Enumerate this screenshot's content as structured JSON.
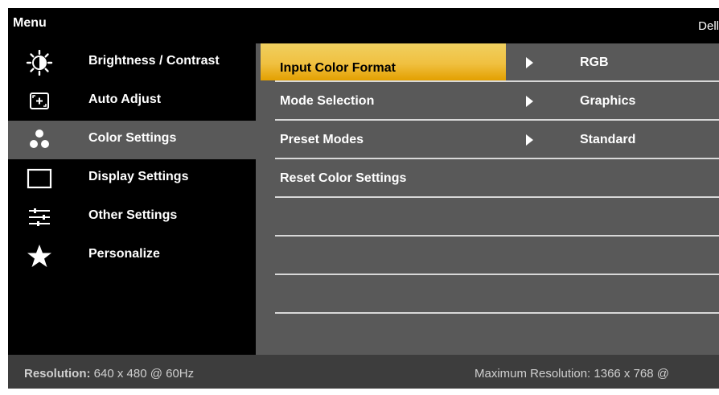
{
  "header": {
    "menu_title": "Menu",
    "brand": "Dell "
  },
  "sidebar": {
    "items": [
      {
        "label": "Brightness / Contrast",
        "icon": "brightness-icon",
        "selected": false
      },
      {
        "label": "Auto Adjust",
        "icon": "auto-adjust-icon",
        "selected": false
      },
      {
        "label": "Color Settings",
        "icon": "color-dots-icon",
        "selected": true
      },
      {
        "label": "Display Settings",
        "icon": "display-icon",
        "selected": false
      },
      {
        "label": "Other Settings",
        "icon": "sliders-icon",
        "selected": false
      },
      {
        "label": "Personalize",
        "icon": "star-icon",
        "selected": false
      }
    ]
  },
  "panel": {
    "rows": [
      {
        "label": "Input Color Format",
        "value": "RGB",
        "has_arrow": true,
        "highlighted": true
      },
      {
        "label": "Mode Selection",
        "value": "Graphics",
        "has_arrow": true,
        "highlighted": false
      },
      {
        "label": "Preset Modes",
        "value": "Standard",
        "has_arrow": true,
        "highlighted": false
      },
      {
        "label": "Reset Color Settings",
        "value": "",
        "has_arrow": false,
        "highlighted": false
      },
      {
        "label": "",
        "value": "",
        "has_arrow": false,
        "highlighted": false
      },
      {
        "label": "",
        "value": "",
        "has_arrow": false,
        "highlighted": false
      },
      {
        "label": "",
        "value": "",
        "has_arrow": false,
        "highlighted": false
      }
    ]
  },
  "footer": {
    "resolution_label": "Resolution:",
    "resolution_value": "640 x 480 @ 60Hz",
    "max_resolution": "Maximum Resolution: 1366 x 768 @"
  },
  "colors": {
    "highlight": "#f0c040",
    "panel_bg": "#595959",
    "selected_bg": "#595959",
    "footer_bg": "#3d3d3d"
  }
}
